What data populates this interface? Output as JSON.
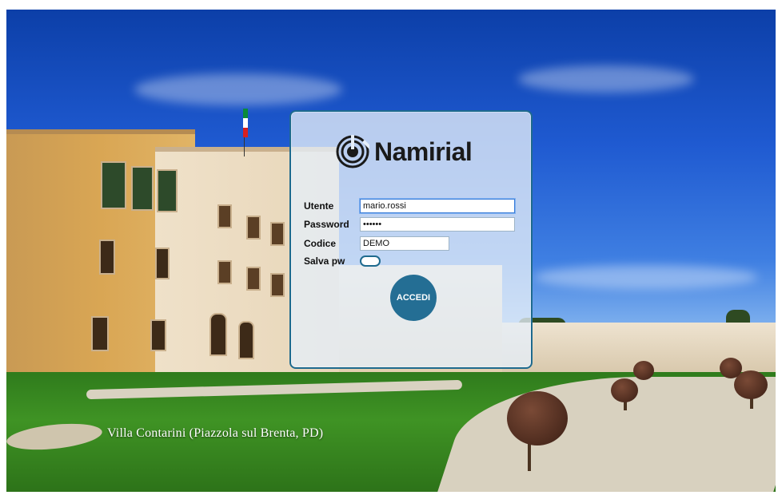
{
  "background": {
    "caption": "Villa Contarini (Piazzola sul Brenta, PD)"
  },
  "login": {
    "logo_text": "Namirial",
    "logo_icon": "namirial-logo-icon",
    "utente": {
      "label": "Utente",
      "value": "mario.rossi"
    },
    "password": {
      "label": "Password",
      "value": "••••••"
    },
    "codice": {
      "label": "Codice",
      "value": "DEMO"
    },
    "salva_pw": {
      "label": "Salva pw",
      "enabled": false
    },
    "submit_label": "ACCEDI"
  },
  "colors": {
    "accent": "#246e94",
    "panel_border": "#1e6a8e"
  }
}
